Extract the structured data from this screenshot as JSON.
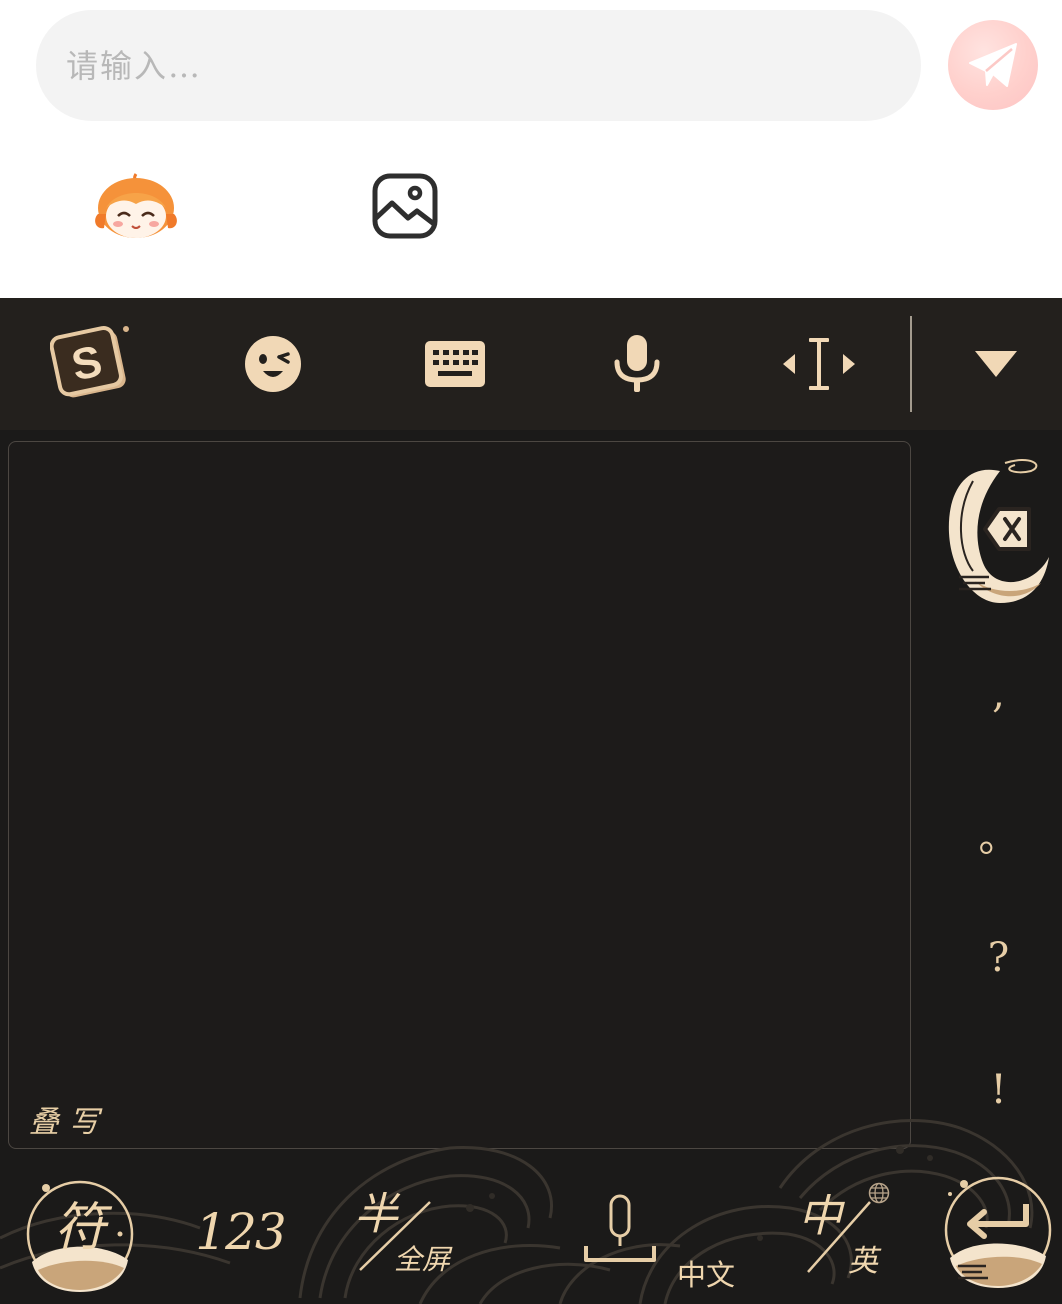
{
  "composer": {
    "input_placeholder": "请输入…",
    "send_icon": "paper-plane-icon",
    "tools": [
      {
        "name": "mascot-sticker-button",
        "icon": "mascot-avatar-icon"
      },
      {
        "name": "image-button",
        "icon": "image-icon"
      }
    ]
  },
  "keyboard": {
    "toolbar": [
      {
        "name": "sogou-logo-button",
        "icon": "sogou-s-icon"
      },
      {
        "name": "emoji-button",
        "icon": "wink-face-icon"
      },
      {
        "name": "keyboard-layout-button",
        "icon": "keyboard-icon"
      },
      {
        "name": "voice-input-button",
        "icon": "microphone-icon"
      },
      {
        "name": "cursor-move-button",
        "icon": "text-cursor-icon"
      },
      {
        "name": "collapse-keyboard-button",
        "icon": "triangle-down-icon"
      }
    ],
    "handwriting_label": "叠写",
    "side_keys": {
      "delete_icon": "backspace-icon",
      "punctuation": [
        ",",
        "。",
        "?",
        "!"
      ]
    },
    "bottom_row": {
      "symbol_key": "符",
      "number_key": "123",
      "half_full_top": "半",
      "half_full_bottom": "全屏",
      "space_label": "中文",
      "lang_top": "中",
      "lang_bottom": "英",
      "enter_icon": "enter-arrow-icon"
    },
    "colors": {
      "background": "#1b1a19",
      "toolbar": "#23201d",
      "accent_gold": "#e8cfa6"
    }
  }
}
